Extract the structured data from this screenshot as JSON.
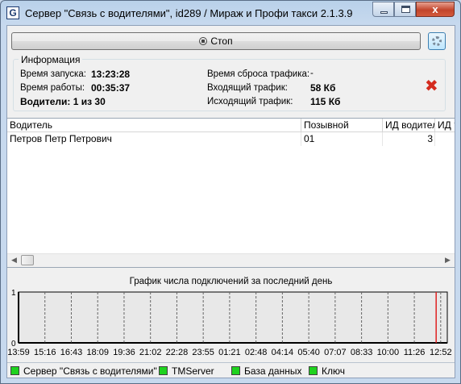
{
  "window": {
    "title": "Сервер \"Связь с водителями\", id289 / Мираж и Профи такси 2.1.3.9",
    "app_icon": "G",
    "close_glyph": "x"
  },
  "toolbar": {
    "stop_label": "Стоп",
    "settings_icon": "gear-icon"
  },
  "info": {
    "legend": "Информация",
    "start_label": "Время запуска:",
    "start_value": "13:23:28",
    "uptime_label": "Время работы:",
    "uptime_value": "00:35:37",
    "drivers_label": "Водители: 1 из 30",
    "reset_label": "Время сброса трафика:",
    "reset_value": "-",
    "in_label": "Входящий трафик:",
    "in_value": "58 Кб",
    "out_label": "Исходящий трафик:",
    "out_value": "115 Кб",
    "reset_icon": "red-x-icon"
  },
  "table": {
    "columns": [
      "Водитель",
      "Позывной",
      "ИД водителя",
      "ИД ?"
    ],
    "rows": [
      {
        "driver": "Петров Петр Петрович",
        "callsign": "01",
        "driver_id": "3",
        "extra": ""
      }
    ]
  },
  "chart_data": {
    "type": "line",
    "title": "График числа подключений за последний день",
    "ylim": [
      0,
      1
    ],
    "y_ticks": [
      "1",
      "0"
    ],
    "x_ticks": [
      "13:59",
      "15:16",
      "16:43",
      "18:09",
      "19:36",
      "21:02",
      "22:28",
      "23:55",
      "01:21",
      "02:48",
      "04:14",
      "05:40",
      "07:07",
      "08:33",
      "10:00",
      "11:26",
      "12:52"
    ],
    "values": [
      0
    ],
    "grid": true,
    "current_marker_color": "#e02020"
  },
  "status": {
    "items": [
      {
        "label": "Сервер \"Связь с водителями\"",
        "color": "#1fd21f"
      },
      {
        "label": "TMServer",
        "color": "#1fd21f"
      },
      {
        "label": "База данных",
        "color": "#1fd21f"
      },
      {
        "label": "Ключ",
        "color": "#1fd21f"
      }
    ]
  }
}
